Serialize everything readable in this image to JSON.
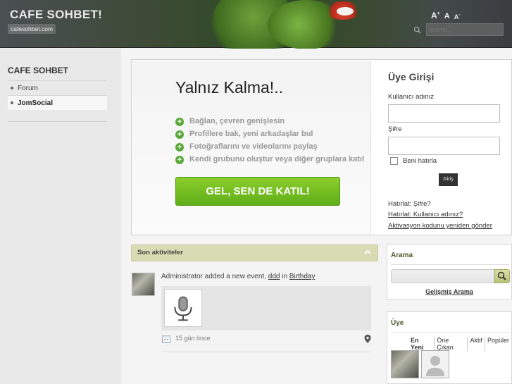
{
  "header": {
    "site_title": "CAFE SOHBET!",
    "site_url": "cafesohbet.com",
    "font_increase": "A+",
    "font_reset": "A",
    "font_decrease": "A-",
    "search_placeholder": "arama..."
  },
  "sidebar": {
    "title": "CAFE SOHBET",
    "items": [
      {
        "label": "Forum"
      },
      {
        "label": "JomSocial"
      }
    ]
  },
  "hero": {
    "title": "Yalnız Kalma!..",
    "features": [
      "Bağlan, çevren genişlesin",
      "Profillere bak, yeni arkadaşlar bul",
      "Fotoğraflarını ve videolarını paylaş",
      "Kendi grubunu oluştur veya diğer gruplara katıl"
    ],
    "join_button": "GEL, SEN DE KATIL!"
  },
  "login": {
    "title": "Üye Girişi",
    "username_label": "Kullanıcı adınız",
    "password_label": "Şifre",
    "remember_label": "Beni hatırla",
    "submit_label": "Giriş",
    "remind_password": "Hatırlat: Şifre?",
    "remind_username": "Hatırlat: Kullanıcı adınız?",
    "resend_activation": "Aktivasyon kodunu yeniden gönder"
  },
  "activity": {
    "title": "Son aktiviteler",
    "entry": {
      "actor": "Administrator",
      "action": " added a new event, ",
      "event": "ddd",
      "connector": " in ",
      "category": "Birthday",
      "time": "15 gün önce"
    }
  },
  "search_box": {
    "title": "Arama",
    "advanced_link": "Gelişmiş Arama"
  },
  "members_box": {
    "title": "Üye",
    "tabs": [
      "En Yeni",
      "Öne Çıkan",
      "Aktif",
      "Popüler"
    ]
  },
  "colors": {
    "join_button": "#6cbc20",
    "accent_green": "#4c5a28",
    "activity_header": "#d9dbb4"
  }
}
